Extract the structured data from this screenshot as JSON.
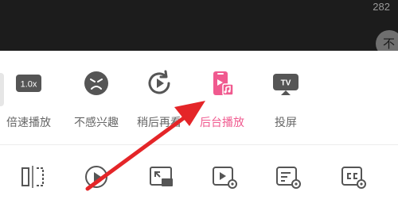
{
  "top": {
    "count": "282",
    "avatar_char": "不"
  },
  "actions": [
    {
      "label": "倍速播放",
      "icon": "speed-badge-icon",
      "badge": "1.0x"
    },
    {
      "label": "不感兴趣",
      "icon": "dislike-face-icon"
    },
    {
      "label": "稍后再看",
      "icon": "watch-later-icon"
    },
    {
      "label": "后台播放",
      "icon": "background-play-icon",
      "active": true
    },
    {
      "label": "投屏",
      "icon": "tv-cast-icon",
      "badge": "TV"
    }
  ],
  "tools": [
    "mirror-icon",
    "play-circle-icon",
    "pip-icon",
    "video-settings-icon",
    "list-settings-icon",
    "caption-settings-icon"
  ],
  "colors": {
    "accent": "#f05a8f",
    "annotation_arrow": "#e42528"
  }
}
